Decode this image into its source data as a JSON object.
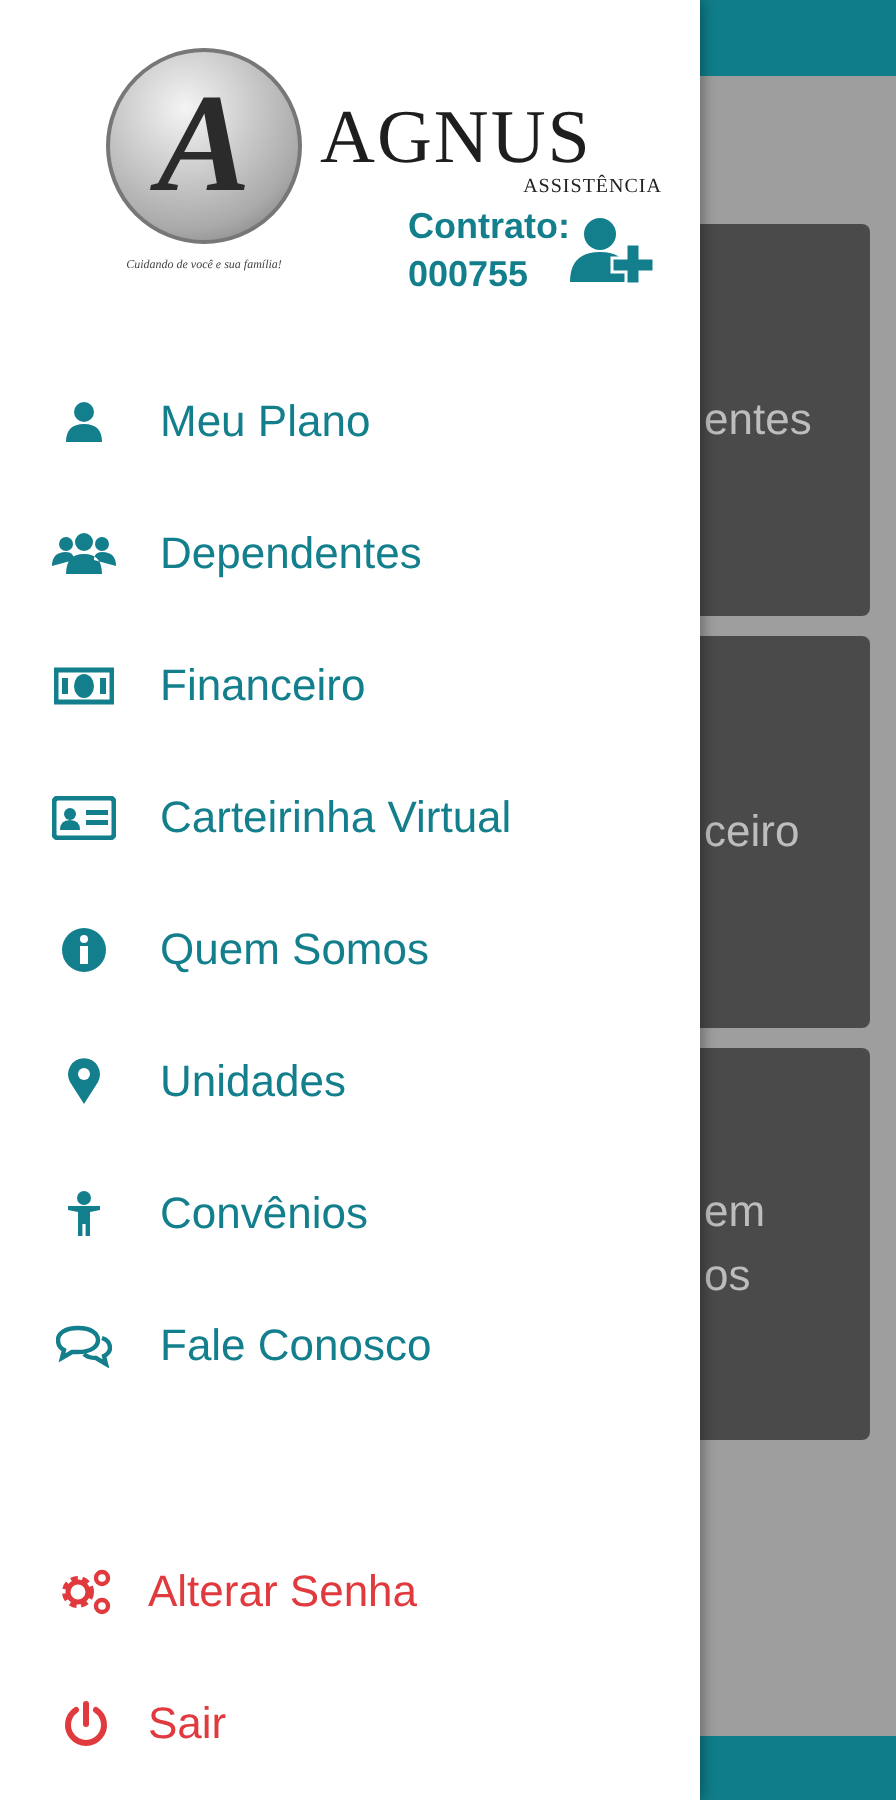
{
  "header": {
    "logo_letter": "A",
    "brand": "AGNUS",
    "subtitle": "ASSISTÊNCIA",
    "tagline": "Cuidando de você e sua família!",
    "contract_label": "Contrato:",
    "contract_number": "000755"
  },
  "menu": [
    {
      "label": "Meu Plano"
    },
    {
      "label": "Dependentes"
    },
    {
      "label": "Financeiro"
    },
    {
      "label": "Carteirinha Virtual"
    },
    {
      "label": "Quem Somos"
    },
    {
      "label": "Unidades"
    },
    {
      "label": "Convênios"
    },
    {
      "label": "Fale Conosco"
    }
  ],
  "footer_menu": [
    {
      "label": "Alterar Senha"
    },
    {
      "label": "Sair"
    }
  ],
  "background_cards": [
    {
      "lines": [
        "entes"
      ]
    },
    {
      "lines": [
        "ceiro"
      ]
    },
    {
      "lines": [
        "em",
        "os"
      ]
    }
  ]
}
